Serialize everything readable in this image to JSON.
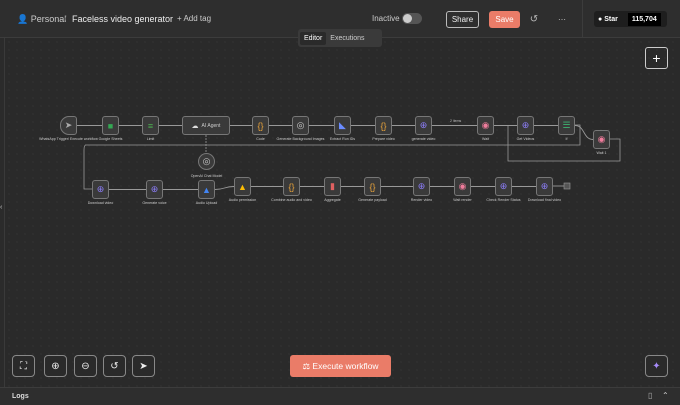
{
  "header": {
    "project": "Personal",
    "workflow_name": "Faceless video generator",
    "add_tag": "+ Add tag",
    "status": "Inactive",
    "share": "Share",
    "save": "Save",
    "github_star": "Star",
    "github_count": "115,704"
  },
  "tabs": [
    {
      "label": "Editor",
      "active": true
    },
    {
      "label": "Executions",
      "active": false
    }
  ],
  "nodes": [
    {
      "label": "WhatsApp Trigger/ Execute workflow",
      "icon": "cursor-icon"
    },
    {
      "label": "Google Sheets",
      "icon": "sheets-icon"
    },
    {
      "label": "Limit",
      "icon": "limit-icon"
    },
    {
      "label": "AI Agent",
      "icon": "robot-icon"
    },
    {
      "label": "Code",
      "icon": "code-icon"
    },
    {
      "label": "Generate Background Images",
      "icon": "openai-icon"
    },
    {
      "label": "Extract Run IDs",
      "icon": "extract-icon"
    },
    {
      "label": "Prepare video",
      "icon": "code-icon"
    },
    {
      "label": "generate video",
      "icon": "globe-icon"
    },
    {
      "label": "Wait",
      "icon": "wait-icon"
    },
    {
      "label": "Get Videos",
      "icon": "globe-icon"
    },
    {
      "label": "If",
      "icon": "if-icon"
    },
    {
      "label": "Wait 1",
      "icon": "wait-icon"
    },
    {
      "label": "OpenAI Chat Model",
      "icon": "openai-icon"
    },
    {
      "label": "Download video",
      "icon": "globe-icon"
    },
    {
      "label": "Generate voice",
      "icon": "globe-icon"
    },
    {
      "label": "Audio Upload",
      "icon": "drive-icon"
    },
    {
      "label": "Audio permission",
      "icon": "drive-icon"
    },
    {
      "label": "Combine audio and video",
      "icon": "code-icon"
    },
    {
      "label": "Aggregate",
      "icon": "aggregate-icon"
    },
    {
      "label": "Generate payload",
      "icon": "code-icon"
    },
    {
      "label": "Render video",
      "icon": "globe-icon"
    },
    {
      "label": "Wait render",
      "icon": "wait-icon"
    },
    {
      "label": "Check Render Status",
      "icon": "globe-icon"
    },
    {
      "label": "Download final video",
      "icon": "globe-icon"
    }
  ],
  "edge_label": "2 items",
  "execute_button": "Execute workflow",
  "logs": {
    "label": "Logs"
  },
  "colors": {
    "accent": "#ea7c68",
    "canvas": "#2a2a2a"
  }
}
